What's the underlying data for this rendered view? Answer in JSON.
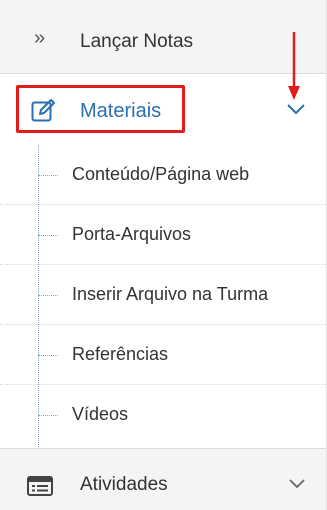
{
  "menu": {
    "lancar_notas": {
      "label": "Lançar Notas",
      "icon": "double-chevron-right-icon"
    },
    "materiais": {
      "label": "Materiais",
      "icon": "edit-icon",
      "expanded": true,
      "highlight_color": "#e21b1b",
      "label_color": "#2a6fb2"
    },
    "submenu": [
      {
        "label": "Conteúdo/Página web"
      },
      {
        "label": "Porta-Arquivos"
      },
      {
        "label": "Inserir Arquivo na Turma"
      },
      {
        "label": "Referências"
      },
      {
        "label": "Vídeos"
      }
    ],
    "atividades": {
      "label": "Atividades",
      "icon": "list-icon",
      "expanded": false
    }
  },
  "annotation": {
    "arrow_color": "#e21b1b",
    "arrow_icon": "red-arrow-down-icon"
  }
}
